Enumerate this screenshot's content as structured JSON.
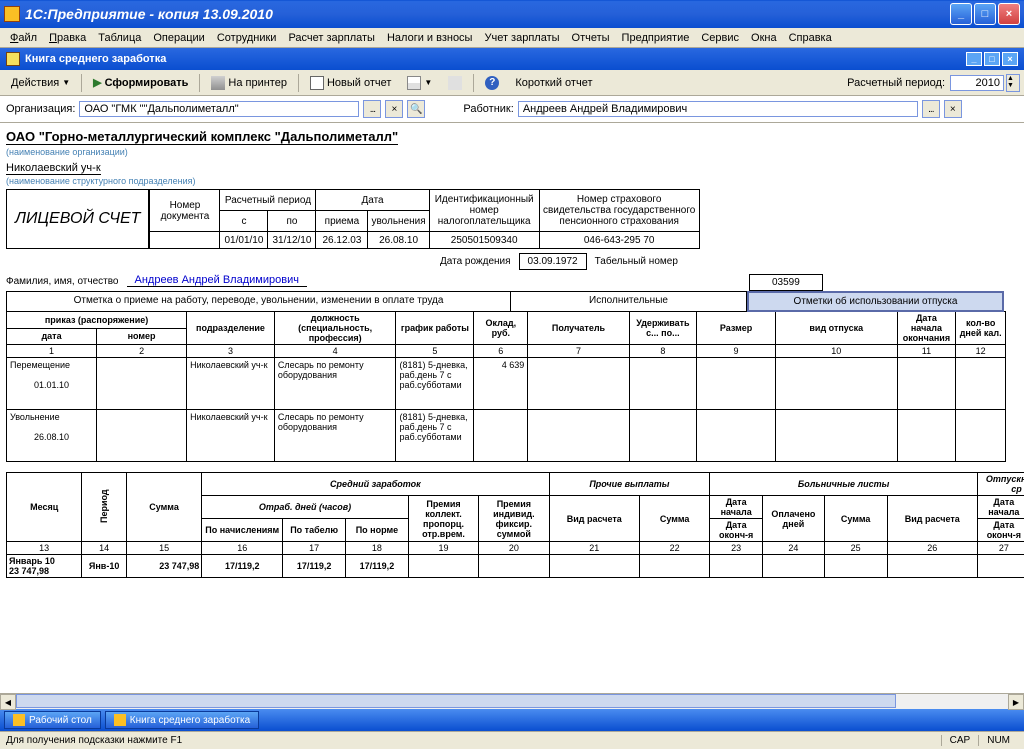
{
  "window": {
    "title": "1С:Предприятие - копия 13.09.2010"
  },
  "menu": [
    "Файл",
    "Правка",
    "Таблица",
    "Операции",
    "Сотрудники",
    "Расчет зарплаты",
    "Налоги и взносы",
    "Учет зарплаты",
    "Отчеты",
    "Предприятие",
    "Сервис",
    "Окна",
    "Справка"
  ],
  "subwindow": {
    "title": "Книга среднего заработка"
  },
  "toolbar": {
    "actions": "Действия",
    "form": "Сформировать",
    "printer": "На принтер",
    "newreport": "Новый отчет",
    "shortreport": "Короткий отчет",
    "period_label": "Расчетный период:",
    "period_value": "2010"
  },
  "filters": {
    "org_label": "Организация:",
    "org_value": "ОАО \"ГМК \"\"Дальполиметалл\"",
    "emp_label": "Работник:",
    "emp_value": "Андреев Андрей Владимирович"
  },
  "report": {
    "org_full": "ОАО \"Горно-металлургический комплекс \"Дальполиметалл\"",
    "org_note": "(наименование организации)",
    "dept": "Николаевский уч-к",
    "dept_note": "(наименование структурного подразделения)",
    "form_title": "ЛИЦЕВОЙ СЧЕТ",
    "headers": {
      "doc_num": "Номер документа",
      "calc_period": "Расчетный период",
      "from": "с",
      "to": "по",
      "date": "Дата",
      "hire": "приема",
      "fire": "увольнения",
      "inn": "Идентификационный номер налогоплательщика",
      "sniis": "Номер страхового свидетельства государственного пенсионного страхования"
    },
    "values": {
      "from": "01/01/10",
      "to": "31/12/10",
      "hire": "26.12.03",
      "fire": "26.08.10",
      "inn": "250501509340",
      "sniis": "046-643-295 70"
    },
    "fio_label": "Фамилия, имя, отчество",
    "fio_value": "Андреев Андрей Владимирович",
    "birth_label": "Дата рождения",
    "birth_value": "03.09.1972",
    "tabnum_label": "Табельный номер",
    "tabnum_value": "03599",
    "sections": {
      "hire_note": "Отметка о приеме на работу, переводе, увольнении, изменении в оплате труда",
      "exec": "Исполнительные",
      "vacation": "Отметки об использовании отпуска"
    },
    "detail_headers": {
      "order": "приказ (распоряжение)",
      "date": "дата",
      "number": "номер",
      "dept": "подразделение",
      "position": "должность (специальность, профессия)",
      "schedule": "график работы",
      "salary": "Оклад, руб.",
      "recipient": "Получатель",
      "withhold": "Удерживать с...   по...",
      "size": "Размер",
      "vac_type": "вид отпуска",
      "start_date": "Дата начала окончания",
      "days": "кол-во дней кал."
    },
    "detail_rows": [
      {
        "action": "Перемещение",
        "date": "01.01.10",
        "dept": "Николаевский уч-к",
        "position": "Слесарь по ремонту оборудования",
        "schedule": "(8181) 5-дневка, раб.день 7 с раб.субботами",
        "salary": "4 639"
      },
      {
        "action": "Увольнение",
        "date": "26.08.10",
        "dept": "Николаевский уч-к",
        "position": "Слесарь по ремонту оборудования",
        "schedule": "(8181) 5-дневка, раб.день 7 с раб.субботами",
        "salary": ""
      }
    ],
    "periods": {
      "month": "Месяц",
      "period": "Период",
      "sum": "Сумма",
      "avg_earn": "Средний заработок",
      "worked": "Отраб. дней (часов)",
      "by_accrual": "По начислениям",
      "by_timesheet": "По табелю",
      "by_norm": "По норме",
      "bonus_coll": "Премия коллект. пропорц. отр.врем.",
      "bonus_ind": "Премия индивид. фиксир. суммой",
      "other_pay": "Прочие выплаты",
      "calc_type": "Вид расчета",
      "sick": "Больничные листы",
      "start": "Дата начала",
      "end": "Дата оконч-я",
      "paid_days": "Оплачено дней",
      "vacation": "Отпускные и ср"
    },
    "period_row": {
      "month": "Январь 10",
      "total": "23 747,98",
      "period": "Янв-10",
      "sum": "23 747,98",
      "d1": "17/119,2",
      "d2": "17/119,2",
      "d3": "17/119,2"
    }
  },
  "taskbar": {
    "desktop": "Рабочий стол",
    "book": "Книга среднего заработка"
  },
  "statusbar": {
    "hint": "Для получения подсказки нажмите F1",
    "cap": "CAP",
    "num": "NUM"
  }
}
